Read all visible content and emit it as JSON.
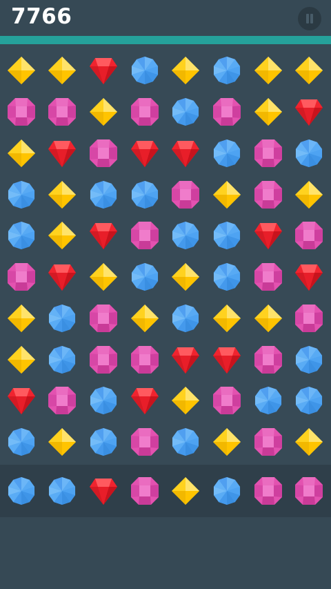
{
  "score": "7766",
  "progress": 1.0,
  "colors": {
    "yellow": "#ffd21f",
    "pink": "#e352b0",
    "red": "#f0242f",
    "blue": "#4ea3f2",
    "accent": "#25a19b",
    "background": "#364955"
  },
  "icons": {
    "pause": "pause-icon"
  },
  "board": [
    [
      "yellow",
      "yellow",
      "red",
      "blue",
      "yellow",
      "blue",
      "yellow",
      "yellow"
    ],
    [
      "pink",
      "pink",
      "yellow",
      "pink",
      "blue",
      "pink",
      "yellow",
      "red"
    ],
    [
      "yellow",
      "red",
      "pink",
      "red",
      "red",
      "blue",
      "pink",
      "blue"
    ],
    [
      "blue",
      "yellow",
      "blue",
      "blue",
      "pink",
      "yellow",
      "pink",
      "yellow"
    ],
    [
      "blue",
      "yellow",
      "red",
      "pink",
      "blue",
      "blue",
      "red",
      "pink"
    ],
    [
      "pink",
      "red",
      "yellow",
      "blue",
      "yellow",
      "blue",
      "pink",
      "red"
    ],
    [
      "yellow",
      "blue",
      "pink",
      "yellow",
      "blue",
      "yellow",
      "yellow",
      "pink"
    ],
    [
      "yellow",
      "blue",
      "pink",
      "pink",
      "red",
      "red",
      "pink",
      "blue"
    ],
    [
      "red",
      "pink",
      "blue",
      "red",
      "yellow",
      "pink",
      "blue",
      "blue"
    ],
    [
      "blue",
      "yellow",
      "blue",
      "pink",
      "blue",
      "yellow",
      "pink",
      "yellow"
    ]
  ],
  "tray": [
    "blue",
    "blue",
    "red",
    "pink",
    "yellow",
    "blue",
    "pink",
    "pink"
  ]
}
